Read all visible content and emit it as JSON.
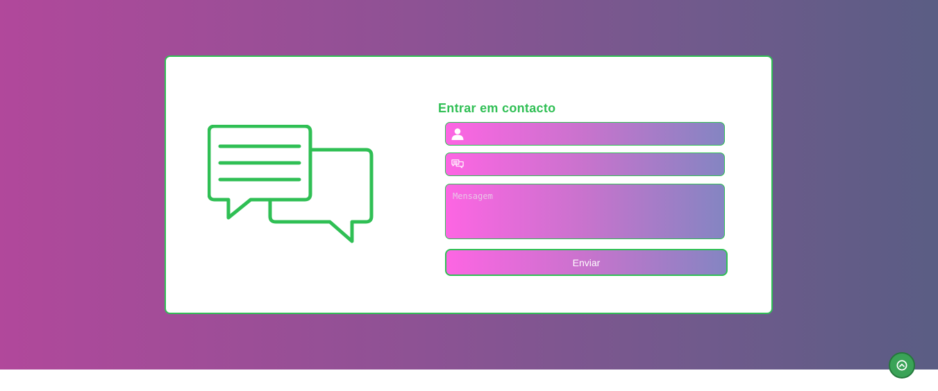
{
  "contact": {
    "title": "Entrar em contacto",
    "name_field": {
      "value": "",
      "placeholder": "",
      "icon": "user-icon"
    },
    "subject_field": {
      "value": "",
      "placeholder": "",
      "icon": "chat-icon"
    },
    "message_field": {
      "value": "",
      "placeholder": "Mensagem"
    },
    "submit_label": "Enviar"
  },
  "illustration": {
    "icon": "speech-bubbles-icon"
  },
  "scroll_top": {
    "icon": "chevron-up-circle-icon"
  },
  "colors": {
    "accent": "#2fbf54",
    "background_gradient_start": "#b1489b",
    "background_gradient_end": "#5a5d84",
    "field_gradient_start": "#fd65e3",
    "field_gradient_end": "#8485c2"
  }
}
